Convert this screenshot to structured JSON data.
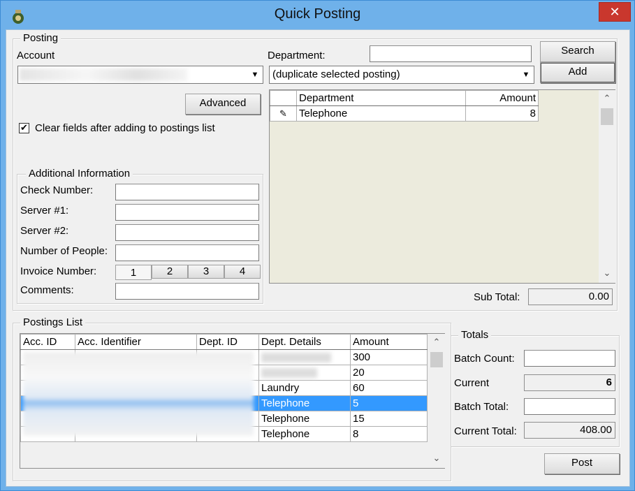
{
  "window": {
    "title": "Quick Posting",
    "close_glyph": "✕",
    "app_icon": "money-bag-icon"
  },
  "posting": {
    "legend": "Posting",
    "account_label": "Account",
    "department_label": "Department:",
    "department_search_value": "",
    "department_combo_value": "(duplicate selected posting)",
    "search_button": "Search",
    "add_button": "Add",
    "advanced_button": "Advanced",
    "clear_fields_label": "Clear fields after adding to postings list",
    "clear_fields_checked": true,
    "grid": {
      "columns": [
        "Department",
        "Amount"
      ],
      "rows": [
        {
          "department": "Telephone",
          "amount": "8"
        }
      ]
    },
    "subtotal_label": "Sub Total:",
    "subtotal_value": "0.00"
  },
  "additional": {
    "legend": "Additional Information",
    "check_number_label": "Check Number:",
    "server1_label": "Server #1:",
    "server2_label": "Server #2:",
    "people_label": "Number of People:",
    "invoice_label": "Invoice Number:",
    "invoice_tabs": [
      "1",
      "2",
      "3",
      "4"
    ],
    "comments_label": "Comments:"
  },
  "postings_list": {
    "legend": "Postings List",
    "columns": [
      "Acc. ID",
      "Acc. Identifier",
      "Dept. ID",
      "Dept. Details",
      "Amount"
    ],
    "rows": [
      {
        "dept_details": "",
        "amount": "300"
      },
      {
        "dept_details": "",
        "amount": "20"
      },
      {
        "dept_details": "Laundry",
        "amount": "60"
      },
      {
        "dept_details": "Telephone",
        "amount": "5",
        "selected": true
      },
      {
        "dept_details": "Telephone",
        "amount": "15"
      },
      {
        "dept_details": "Telephone",
        "amount": "8"
      }
    ]
  },
  "totals": {
    "legend": "Totals",
    "batch_count_label": "Batch Count:",
    "current_label": "Current",
    "current_value": "6",
    "batch_total_label": "Batch Total:",
    "current_total_label": "Current Total:",
    "current_total_value": "408.00",
    "post_button": "Post"
  },
  "colors": {
    "title_bar": "#6fb1ea",
    "close": "#c9372d",
    "selection": "#3399ff",
    "grid_bg": "#ecebdd"
  }
}
